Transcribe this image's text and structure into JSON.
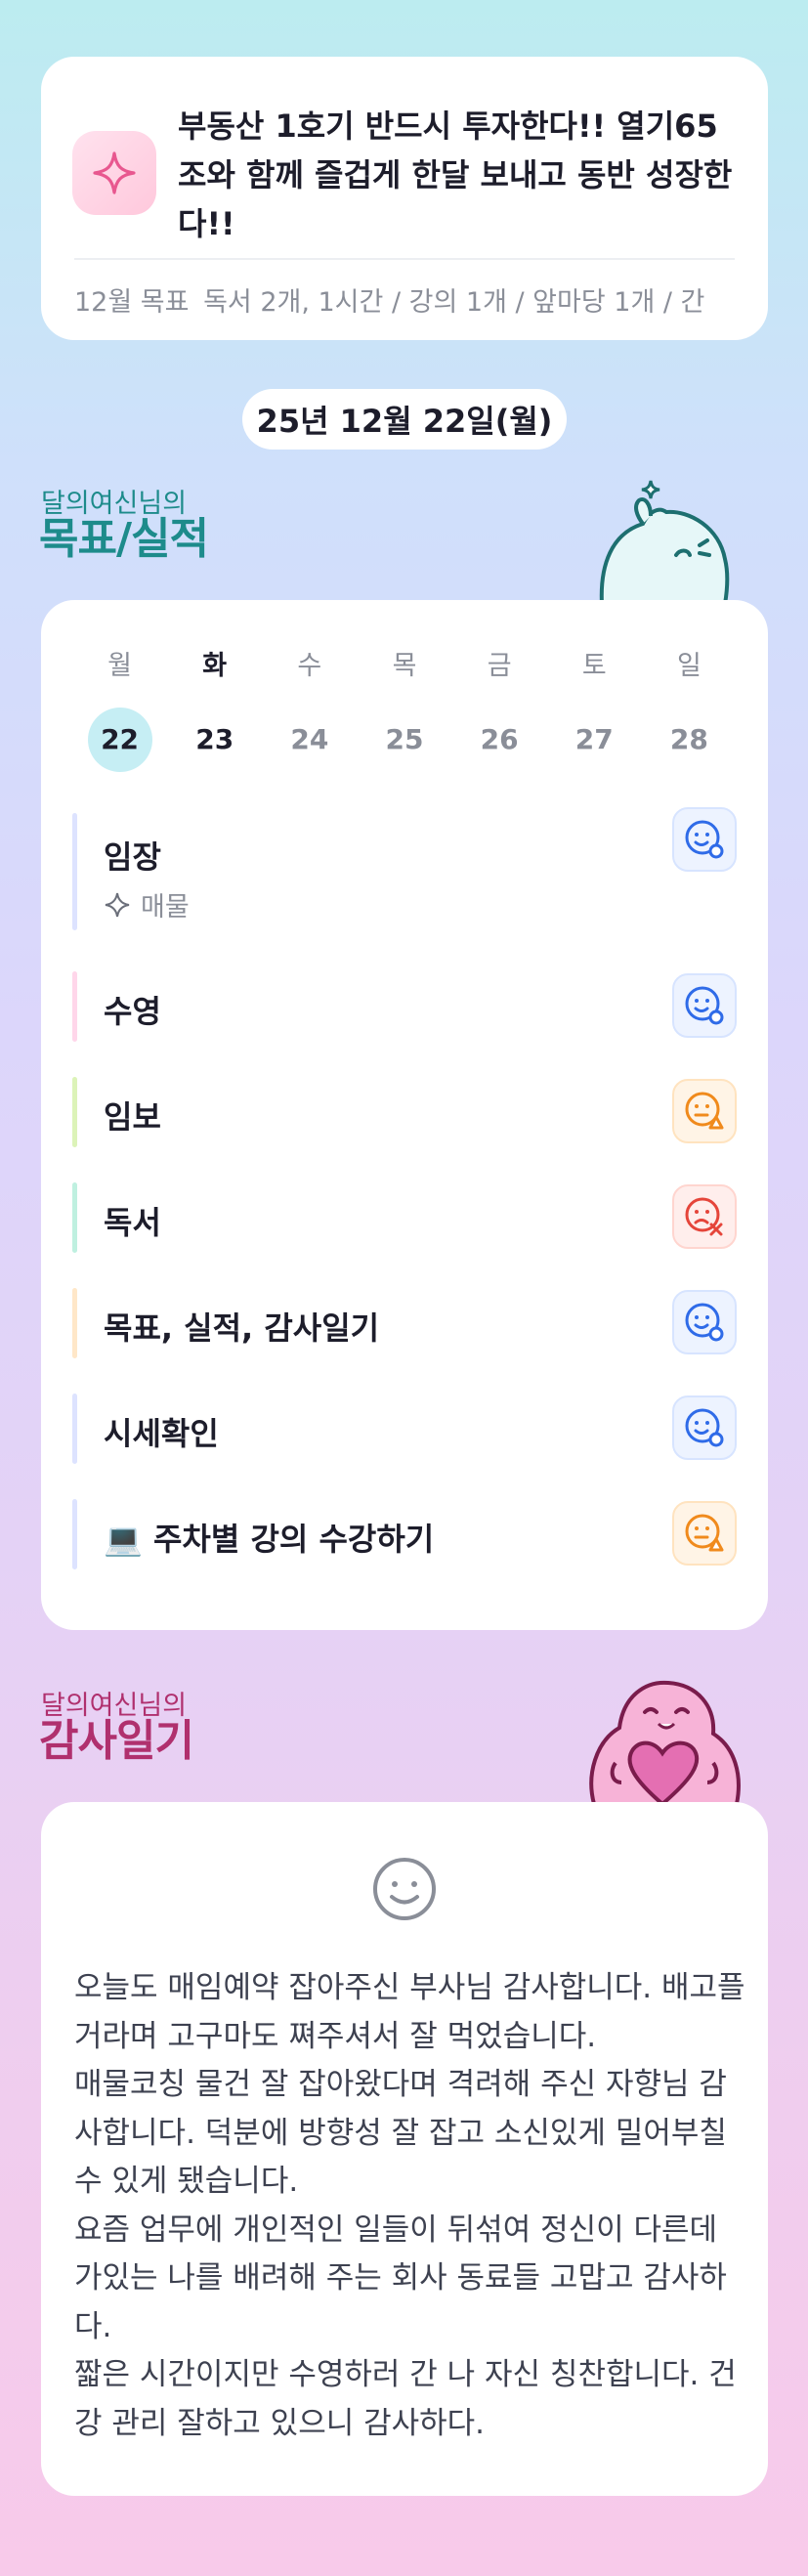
{
  "goal": {
    "icon": "sparkle-icon",
    "title": "부동산 1호기 반드시 투자한다!! 열기65조와 함께 즐겁게 한달 보내고 동반 성장한다!!",
    "summary_label": "12월 목표",
    "summary_text": "독서 2개, 1시간 / 강의 1개 / 앞마당 1개 / 간"
  },
  "date_label": "25년 12월 22일(월)",
  "goals_section": {
    "subtitle": "달의여신님의",
    "title": "목표/실적",
    "accent_color": "#1d8b8b"
  },
  "week": [
    {
      "day": "월",
      "date": "22"
    },
    {
      "day": "화",
      "date": "23"
    },
    {
      "day": "수",
      "date": "24"
    },
    {
      "day": "목",
      "date": "25"
    },
    {
      "day": "금",
      "date": "26"
    },
    {
      "day": "토",
      "date": "27"
    },
    {
      "day": "일",
      "date": "28"
    }
  ],
  "tasks": [
    {
      "name": "임장",
      "sub_icon": "sparkle-icon",
      "sub": "매물",
      "bar_color": "#dde3ff",
      "status": "good-face-icon"
    },
    {
      "name": "수영",
      "bar_color": "#ffd6ea",
      "status": "good-face-icon"
    },
    {
      "name": "임보",
      "bar_color": "#dcf3b8",
      "status": "neutral-face-icon"
    },
    {
      "name": "독서",
      "bar_color": "#bff0e0",
      "status": "sad-face-icon"
    },
    {
      "name": "목표, 실적, 감사일기",
      "bar_color": "#ffe7c8",
      "status": "good-face-icon"
    },
    {
      "name": "시세확인",
      "bar_color": "#dde3ff",
      "status": "good-face-icon"
    },
    {
      "name": "💻 주차별 강의 수강하기",
      "bar_color": "#dde3ff",
      "status": "neutral-face-icon"
    }
  ],
  "gratitude_section": {
    "subtitle": "달의여신님의",
    "title": "감사일기",
    "accent_color": "#b0306e"
  },
  "gratitude": {
    "mood_icon": "smile-face-icon",
    "text": "오늘도 매임예약 잡아주신 부사님 감사합니다. 배고플거라며 고구마도 쪄주셔서 잘 먹었습니다.\n매물코칭 물건 잘 잡아왔다며 격려해 주신 자향님 감사합니다. 덕분에 방향성 잘 잡고 소신있게 밀어부칠 수 있게 됐습니다.\n요즘 업무에 개인적인 일들이 뒤섞여 정신이 다른데 가있는 나를 배려해 주는 회사 동료들 고맙고 감사하다.\n짧은 시간이지만 수영하러 간 나 자신 칭찬합니다. 건강 관리 잘하고 있으니 감사하다."
  }
}
